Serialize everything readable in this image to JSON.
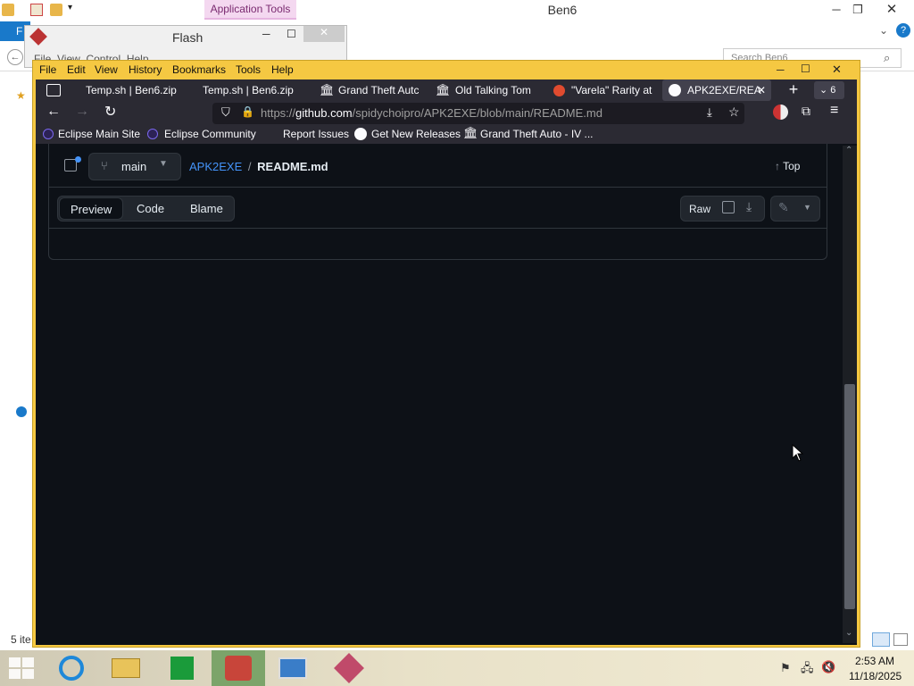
{
  "explorer": {
    "title": "Ben6",
    "app_tools": "Application Tools",
    "file_tab": "F",
    "search_placeholder": "Search Ben6",
    "status": "5 ite"
  },
  "flash": {
    "title": "Flash",
    "menu_fragment": "File  View  Control  Help"
  },
  "firefox": {
    "menu": [
      "File",
      "Edit",
      "View",
      "History",
      "Bookmarks",
      "Tools",
      "Help"
    ],
    "tabs": [
      {
        "label": "Temp.sh | Ben6.zip"
      },
      {
        "label": "Temp.sh | Ben6.zip"
      },
      {
        "label": "Grand Theft Autc"
      },
      {
        "label": "Old Talking Tom"
      },
      {
        "label": "\"Varela\" Rarity at"
      },
      {
        "label": "APK2EXE/REA"
      }
    ],
    "tab_count": "6",
    "url_prefix": "https://",
    "url_host": "github.com",
    "url_path": "/spidychoipro/APK2EXE/blob/main/README.md",
    "bookmarks": [
      "Eclipse Main Site",
      "Eclipse Community",
      "Report Issues",
      "Get New Releases",
      "Grand Theft Auto - IV ..."
    ]
  },
  "github": {
    "branch": "main",
    "repo": "APK2EXE",
    "separator": "/",
    "file": "README.md",
    "top": "Top",
    "view_tabs": [
      "Preview",
      "Code",
      "Blame"
    ],
    "raw": "Raw"
  },
  "taskbar": {
    "time": "2:53 AM",
    "date": "11/18/2025"
  },
  "colors": {
    "firefox_frame": "#f5c842",
    "tab_bar": "#2b2a33",
    "github_bg": "#0d1117",
    "link": "#4493f8",
    "taskbar_active": "#7ca46a"
  }
}
